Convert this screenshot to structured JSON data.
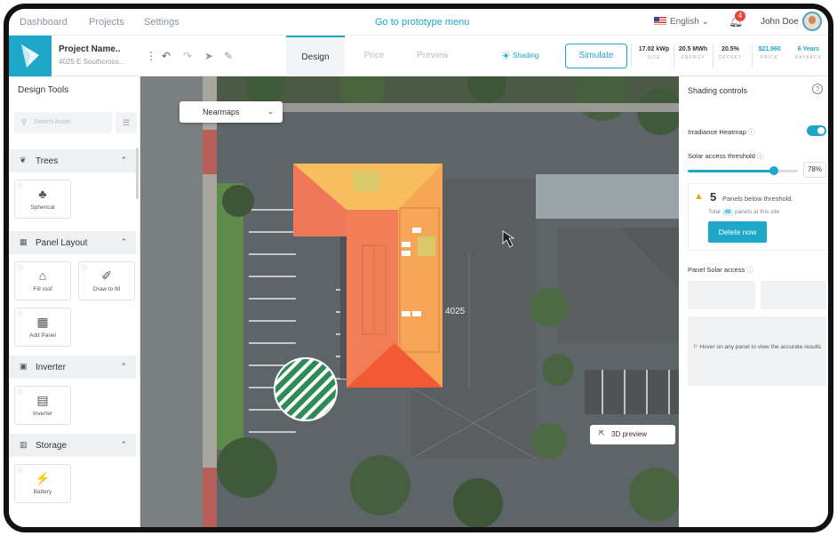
{
  "topnav": {
    "items": [
      "Dashboard",
      "Projects",
      "Settings"
    ],
    "prototype_link": "Go to prototype menu",
    "language": "English",
    "notifications": "4",
    "user": "John Doe"
  },
  "project": {
    "name": "Project Name..",
    "address": "4025 E Southcross..."
  },
  "tabs": [
    "Design",
    "Price",
    "Preview"
  ],
  "shading_label": "Shading",
  "simulate_label": "Simulate",
  "stats": [
    {
      "value": "17.02 kWp",
      "label": "SIZE"
    },
    {
      "value": "20.5 MWh",
      "label": "ENERGY"
    },
    {
      "value": "20.5%",
      "label": "OFFSET"
    },
    {
      "value": "$21,960",
      "label": "PRICE"
    },
    {
      "value": "6 Years",
      "label": "PAYBACK"
    }
  ],
  "design_tools": {
    "title": "Design Tools",
    "search_placeholder": "Search Asset",
    "sections": [
      {
        "label": "Trees",
        "cards": [
          "Spherical"
        ]
      },
      {
        "label": "Panel Layout",
        "cards": [
          "Fill roof",
          "Draw to fill",
          "Add Panel"
        ]
      },
      {
        "label": "Inverter",
        "cards": [
          "Inverter"
        ]
      },
      {
        "label": "Storage",
        "cards": [
          "Battery"
        ]
      }
    ]
  },
  "map": {
    "imagery_source": "Nearmaps",
    "address_label": "4025",
    "preview_3d": "3D preview"
  },
  "shading_panel": {
    "title": "Shading controls",
    "heatmap_label": "Irradiance Heatmap",
    "heatmap_on": true,
    "threshold_label": "Solar access threshold",
    "threshold_value": "78%",
    "threshold_fraction": 0.78,
    "below_count": "5",
    "below_text": "Panels below threshold.",
    "total_prefix": "Total",
    "total_count": "48",
    "total_suffix": "panels at this site",
    "delete_label": "Delete now",
    "panel_access_title": "Panel Solar access",
    "hover_text": "Hover on any panel to view the accurate results"
  },
  "colors": {
    "accent": "#1ea7c9",
    "warning": "#f0a11c"
  }
}
